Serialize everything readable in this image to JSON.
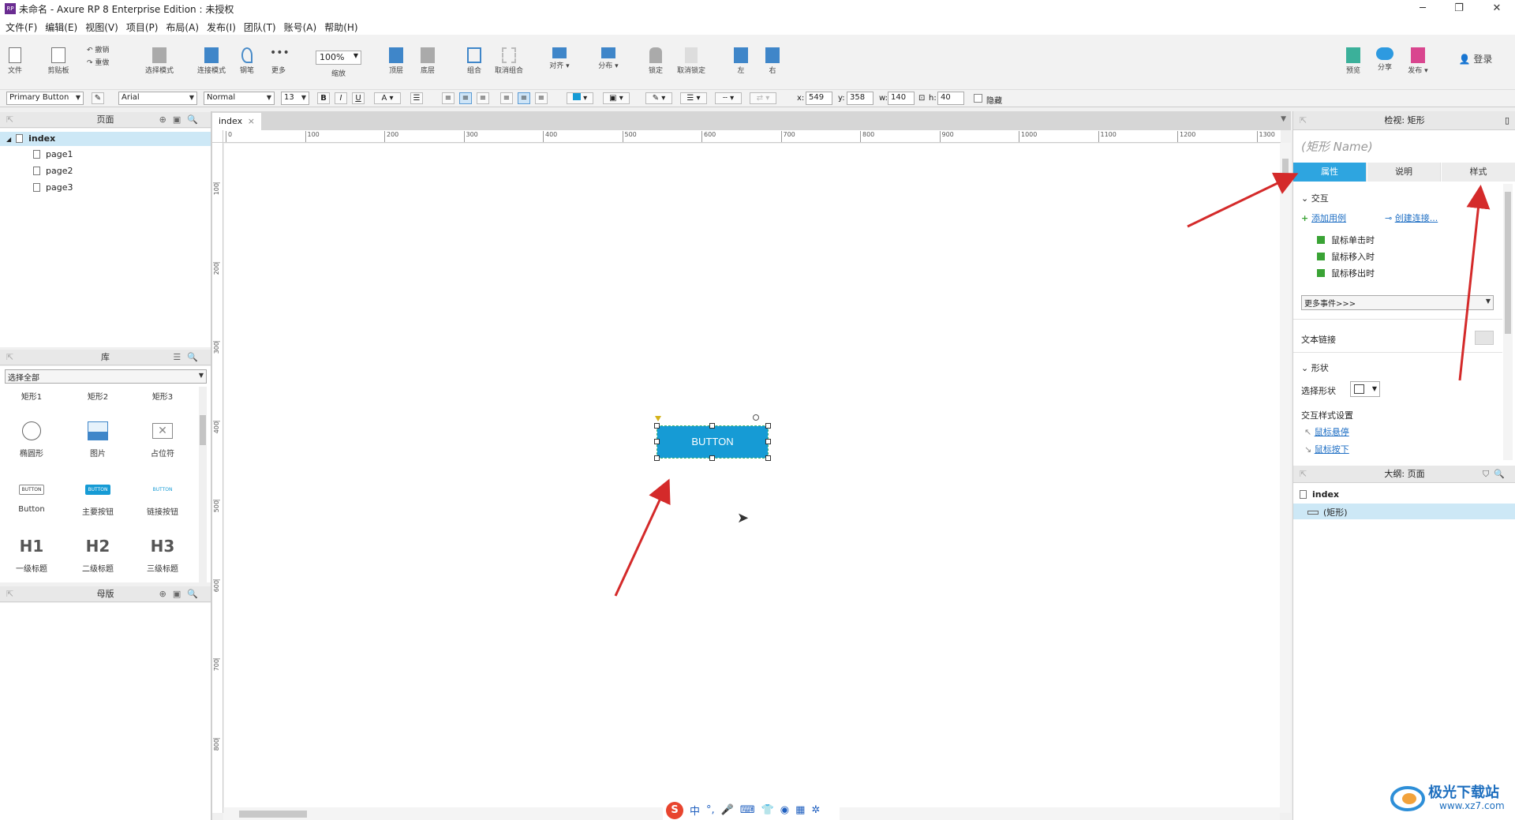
{
  "window": {
    "title": "未命名 - Axure RP 8 Enterprise Edition : 未授权",
    "app_icon_label": "RP",
    "controls": [
      "─",
      "❐",
      "✕"
    ]
  },
  "menu": [
    "文件(F)",
    "编辑(E)",
    "视图(V)",
    "项目(P)",
    "布局(A)",
    "发布(I)",
    "团队(T)",
    "账号(A)",
    "帮助(H)"
  ],
  "toolbar": {
    "file": "文件",
    "clipboard": "剪贴板",
    "undo": "撤销",
    "redo": "重做",
    "select_mode": "选择模式",
    "connect_mode": "连接模式",
    "pen": "钢笔",
    "more": "更多",
    "zoom_value": "100%",
    "zoom_label": "缩放",
    "top": "顶层",
    "bottom": "底层",
    "group": "组合",
    "ungroup": "取消组合",
    "align": "对齐",
    "distribute": "分布",
    "lock": "锁定",
    "unlock": "取消锁定",
    "left": "左",
    "right": "右",
    "preview": "预览",
    "share": "分享",
    "publish": "发布",
    "login": "登录"
  },
  "formatbar": {
    "widget_style": "Primary Button",
    "font": "Arial",
    "font_style": "Normal",
    "font_size": "13",
    "x_label": "x:",
    "x_value": "549",
    "y_label": "y:",
    "y_value": "358",
    "w_label": "w:",
    "w_value": "140",
    "h_label": "h:",
    "h_value": "40",
    "hide_label": "隐藏"
  },
  "pages_panel": {
    "title": "页面",
    "root": "index",
    "children": [
      "page1",
      "page2",
      "page3"
    ]
  },
  "library_panel": {
    "title": "库",
    "filter": "选择全部",
    "row0": [
      "矩形1",
      "矩形2",
      "矩形3"
    ],
    "row1": [
      "椭圆形",
      "图片",
      "占位符"
    ],
    "row2": [
      "Button",
      "主要按钮",
      "链接按钮"
    ],
    "row2_glyphs": [
      "BUTTON",
      "BUTTON",
      "BUTTON"
    ],
    "row3": [
      "一级标题",
      "二级标题",
      "三级标题"
    ],
    "row3_glyphs": [
      "H1",
      "H2",
      "H3"
    ]
  },
  "masters_panel": {
    "title": "母版"
  },
  "canvas": {
    "tab": "index",
    "tab_close": "×",
    "ruler_top": [
      "0",
      "100",
      "200",
      "300",
      "400",
      "500",
      "600",
      "700",
      "800",
      "900",
      "1000",
      "1100",
      "1200",
      "1300"
    ],
    "ruler_left": [
      "100",
      "200",
      "300",
      "400",
      "500",
      "600",
      "700",
      "800"
    ],
    "button_label": "BUTTON"
  },
  "inspector": {
    "title": "检视: 矩形",
    "name_placeholder": "(矩形 Name)",
    "tabs": [
      "属性",
      "说明",
      "样式"
    ],
    "interaction_section": "交互",
    "add_case": "添加用例",
    "create_link": "创建连接...",
    "events": [
      "鼠标单击时",
      "鼠标移入时",
      "鼠标移出时"
    ],
    "more_events": "更多事件>>>",
    "text_link": "文本链接",
    "shape_section": "形状",
    "select_shape": "选择形状",
    "interaction_styles": "交互样式设置",
    "mouse_hover": "鼠标悬停",
    "mouse_down": "鼠标按下"
  },
  "outline": {
    "title": "大纲: 页面",
    "root": "index",
    "child": "(矩形)"
  },
  "ime_bar": [
    "S",
    "中",
    "°,",
    "🎤",
    "⌨",
    "👕",
    "◉",
    "▦",
    "✲"
  ],
  "watermark": {
    "name": "极光下载站",
    "url": "www.xz7.com"
  },
  "colors": {
    "accent": "#2ea5e0",
    "button": "#169bd5",
    "arrow": "#d42a2a"
  }
}
